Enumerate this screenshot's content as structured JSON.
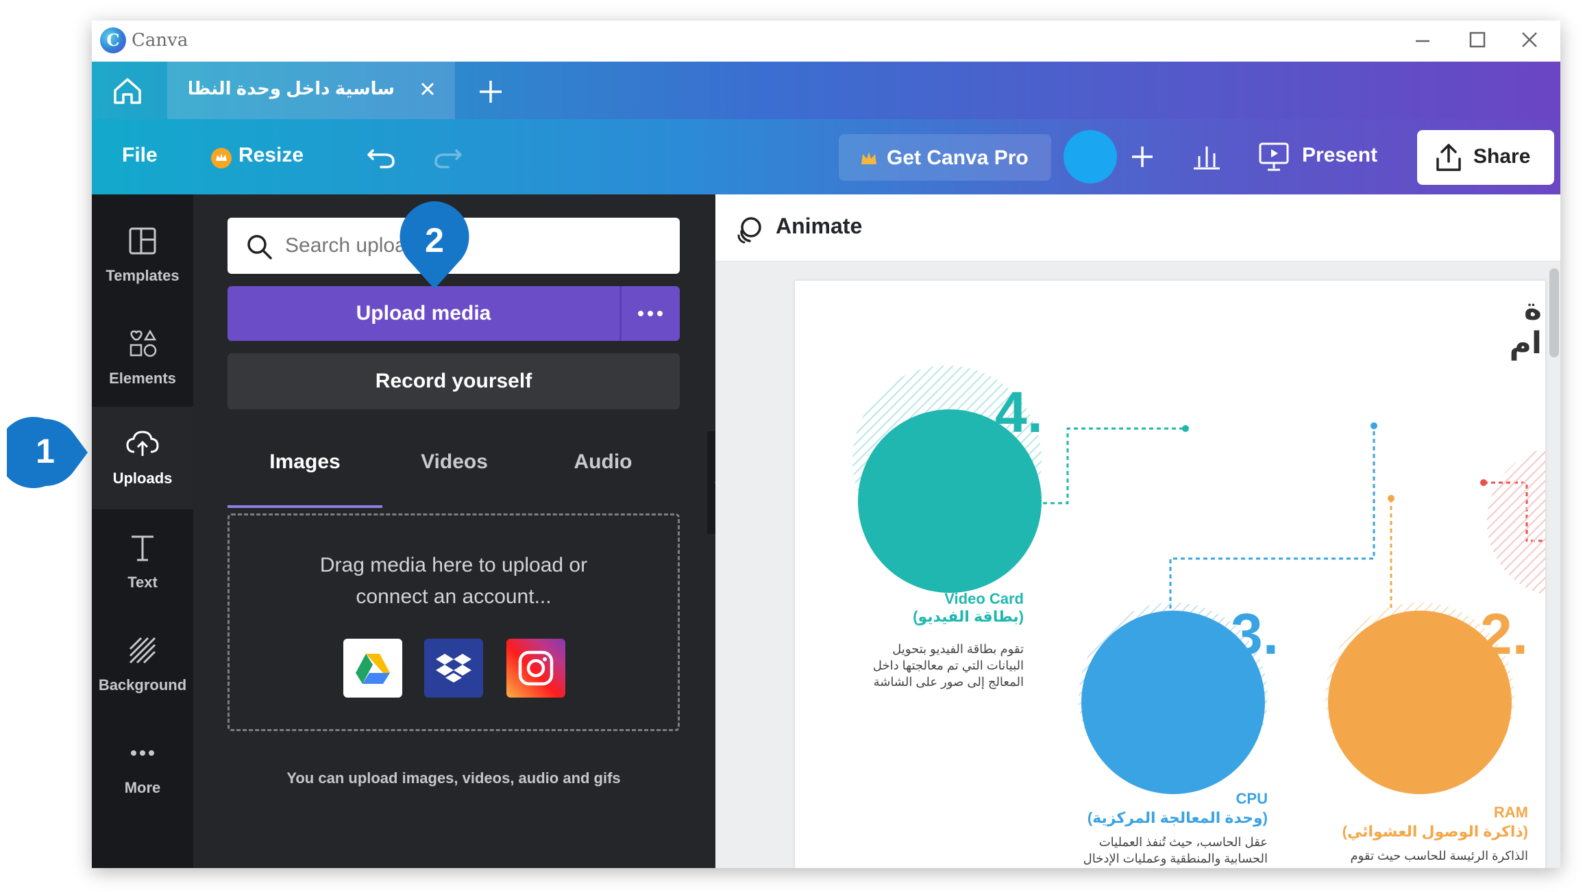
{
  "app": {
    "title": "Canva"
  },
  "tab": {
    "title": "ساسية داخل وحدة النظام…"
  },
  "toolbar": {
    "file": "File",
    "resize": "Resize",
    "get_pro": "Get Canva Pro",
    "present": "Present",
    "share": "Share"
  },
  "rail": {
    "items": [
      {
        "label": "Templates"
      },
      {
        "label": "Elements"
      },
      {
        "label": "Uploads"
      },
      {
        "label": "Text"
      },
      {
        "label": "Background"
      },
      {
        "label": "More"
      }
    ],
    "active": "Uploads"
  },
  "panel": {
    "search_placeholder": "Search uploads",
    "upload_media": "Upload media",
    "record_yourself": "Record yourself",
    "tabs": [
      {
        "label": "Images"
      },
      {
        "label": "Videos"
      },
      {
        "label": "Audio"
      }
    ],
    "active_tab": "Images",
    "dropzone_line1": "Drag media here to upload or",
    "dropzone_line2": "connect an account...",
    "services": [
      "google-drive",
      "dropbox",
      "instagram"
    ],
    "hint": "You can upload images, videos, audio and gifs"
  },
  "canvas": {
    "animate": "Animate",
    "heading_line1": "ة",
    "heading_line2": "ام",
    "items": [
      {
        "number": "4.",
        "title": "Video Card",
        "title_ar": "(بطاقة الفيديو)",
        "desc": "تقوم بطاقة الفيديو بتحويل البيانات التي تم معالجتها داخل المعالج إلى صور على الشاشة",
        "color": "#1fb7b0"
      },
      {
        "number": "3.",
        "title": "CPU",
        "title_ar": "(وحدة المعالجة المركزية)",
        "desc": "عقل الحاسب، حيث تُنفذ العمليات الحسابية والمنطقية وعمليات الإدخال",
        "color": "#3aa3e3"
      },
      {
        "number": "2.",
        "title": "RAM",
        "title_ar": "(ذاكرة الوصول العشوائي)",
        "desc": "الذاكرة الرئيسة للحاسب حيث تقوم",
        "color": "#f4a74a"
      }
    ]
  },
  "callouts": [
    {
      "label": "1"
    },
    {
      "label": "2"
    }
  ],
  "colors": {
    "brand_teal": "#13a9cc",
    "brand_purple": "#6a48c4",
    "upload_button": "#6c4dc8",
    "callout_blue": "#1677c9"
  }
}
